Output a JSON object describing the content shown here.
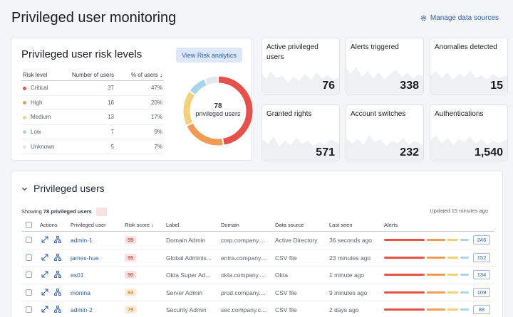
{
  "page": {
    "title": "Privileged user monitoring",
    "manage_link": "Manage data sources"
  },
  "risk": {
    "title": "Privileged user risk levels",
    "button": "View Risk analytics",
    "columns": [
      "Risk level",
      "Number of users",
      "% of users"
    ],
    "rows": [
      {
        "level": "Critical",
        "users": "37",
        "pct": "47%",
        "color": "#e7514b"
      },
      {
        "level": "High",
        "users": "16",
        "pct": "20%",
        "color": "#f09a54"
      },
      {
        "level": "Medium",
        "users": "13",
        "pct": "17%",
        "color": "#f3d07a"
      },
      {
        "level": "Low",
        "users": "7",
        "pct": "9%",
        "color": "#a9d6ea"
      },
      {
        "level": "Unknown",
        "users": "5",
        "pct": "7%",
        "color": "#e3e6ea"
      }
    ],
    "donut_total": "78",
    "donut_label": "privileged users"
  },
  "stats": [
    {
      "label": "Active privileged users",
      "value": "76"
    },
    {
      "label": "Alerts triggered",
      "value": "338"
    },
    {
      "label": "Anomalies detected",
      "value": "15"
    },
    {
      "label": "Granted rights",
      "value": "571"
    },
    {
      "label": "Account switches",
      "value": "232"
    },
    {
      "label": "Authentications",
      "value": "1,540"
    }
  ],
  "users": {
    "title": "Privileged users",
    "showing_prefix": "Showing",
    "showing_count": "78 privileged users",
    "updated": "Updated 15 minutes ago",
    "columns": [
      "Actions",
      "Privileged user",
      "Risk score",
      "Label",
      "Domain",
      "Data source",
      "Last seen",
      "Alerts"
    ],
    "rows": [
      {
        "user": "admin-1",
        "score": "99",
        "label": "Domain Admin",
        "domain": "corp.company....",
        "source": "Active Directory",
        "seen": "36 seconds ago",
        "alerts": "246"
      },
      {
        "user": "james-hue",
        "score": "95",
        "label": "Global Adminis...",
        "domain": "entra.company....",
        "source": "CSV file",
        "seen": "23 minutes ago",
        "alerts": "152"
      },
      {
        "user": "es01",
        "score": "90",
        "label": "Okta Super Ad...",
        "domain": "okta.company....",
        "source": "Okta",
        "seen": "1 minute ago",
        "alerts": "134"
      },
      {
        "user": "monina",
        "score": "83",
        "label": "Server Admin",
        "domain": "prod.company....",
        "source": "CSV file",
        "seen": "9 minutes ago",
        "alerts": "109"
      },
      {
        "user": "admin-2",
        "score": "79",
        "label": "Security Admin",
        "domain": "sec.company.c...",
        "source": "CSV file",
        "seen": "2 days ago",
        "alerts": "88"
      }
    ]
  }
}
